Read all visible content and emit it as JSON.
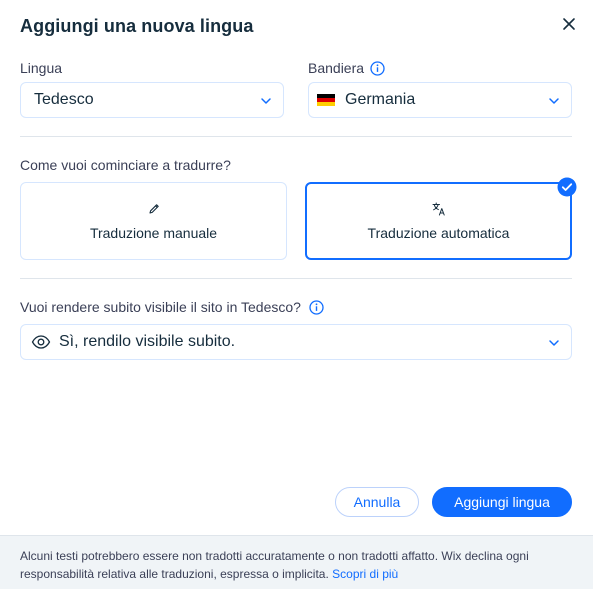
{
  "dialog": {
    "title": "Aggiungi una nuova lingua",
    "close_icon": "close-icon"
  },
  "language": {
    "label": "Lingua",
    "value": "Tedesco"
  },
  "flag": {
    "label": "Bandiera",
    "value": "Germania",
    "colors": [
      "#000000",
      "#dd0000",
      "#ffce00"
    ]
  },
  "translate": {
    "question": "Come vuoi cominciare a tradurre?",
    "options": [
      {
        "label": "Traduzione manuale",
        "icon": "pencil-icon",
        "selected": false
      },
      {
        "label": "Traduzione automatica",
        "icon": "translate-icon",
        "selected": true
      }
    ]
  },
  "visibility": {
    "question": "Vuoi rendere subito visibile il sito in Tedesco?",
    "value": "Sì, rendilo visibile subito.",
    "icon": "eye-icon"
  },
  "buttons": {
    "cancel": "Annulla",
    "add": "Aggiungi lingua"
  },
  "footer": {
    "text": "Alcuni testi potrebbero essere non tradotti accuratamente o non tradotti affatto. Wix declina ogni responsabilità relativa alle traduzioni, espressa o implicita.",
    "link": "Scopri di più"
  },
  "colors": {
    "accent": "#116dff",
    "border": "#d6e6fe",
    "footer_bg": "#f0f4f7",
    "text": "#162d3d"
  }
}
